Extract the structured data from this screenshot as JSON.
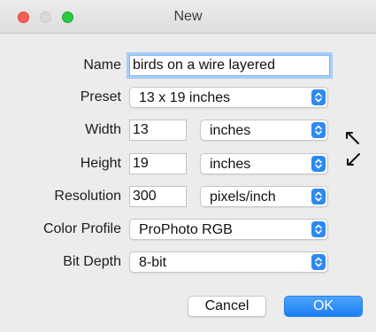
{
  "window": {
    "title": "New"
  },
  "form": {
    "name": {
      "label": "Name",
      "value": "birds on a wire layered"
    },
    "preset": {
      "label": "Preset",
      "selected": "13 x 19 inches"
    },
    "width": {
      "label": "Width",
      "value": "13",
      "unit": "inches"
    },
    "height": {
      "label": "Height",
      "value": "19",
      "unit": "inches"
    },
    "resolution": {
      "label": "Resolution",
      "value": "300",
      "unit": "pixels/inch"
    },
    "color_profile": {
      "label": "Color Profile",
      "selected": "ProPhoto RGB"
    },
    "bit_depth": {
      "label": "Bit Depth",
      "selected": "8-bit"
    }
  },
  "buttons": {
    "cancel": "Cancel",
    "ok": "OK"
  },
  "icons": {
    "traffic_lights": [
      "close-icon",
      "minimize-icon",
      "zoom-icon"
    ],
    "popup_arrows": "chevron-up-down-icon",
    "swap": "swap-dimensions-icon"
  },
  "colors": {
    "accent": "#2e89f0",
    "close": "#fc5f57",
    "zoom": "#2bc841",
    "focus_ring": "#a9cdf5"
  }
}
